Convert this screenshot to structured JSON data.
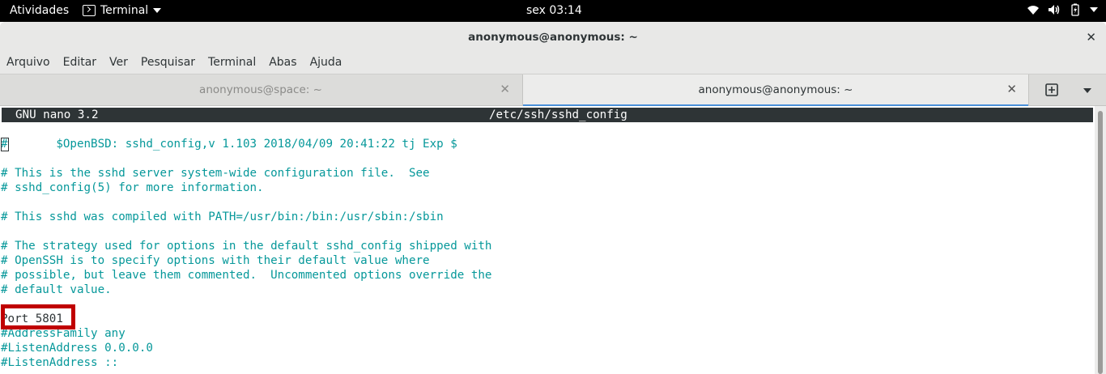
{
  "topbar": {
    "activities": "Atividades",
    "app_name": "Terminal",
    "clock": "sex 03:14",
    "tray_icons": [
      "wifi-icon",
      "volume-icon",
      "battery-icon",
      "system-menu-caret"
    ]
  },
  "window": {
    "title": "anonymous@anonymous: ~",
    "close_glyph": "✕"
  },
  "menu": [
    "Arquivo",
    "Editar",
    "Ver",
    "Pesquisar",
    "Terminal",
    "Abas",
    "Ajuda"
  ],
  "tabs": [
    {
      "label": "anonymous@space: ~",
      "active": false,
      "close_glyph": "✕"
    },
    {
      "label": "anonymous@anonymous: ~",
      "active": true,
      "close_glyph": "✕"
    }
  ],
  "nano": {
    "version": "GNU nano 3.2",
    "filename": "/etc/ssh/sshd_config"
  },
  "lines": [
    "#       $OpenBSD: sshd_config,v 1.103 2018/04/09 20:41:22 tj Exp $",
    "",
    "# This is the sshd server system-wide configuration file.  See",
    "# sshd_config(5) for more information.",
    "",
    "# This sshd was compiled with PATH=/usr/bin:/bin:/usr/sbin:/sbin",
    "",
    "# The strategy used for options in the default sshd_config shipped with",
    "# OpenSSH is to specify options with their default value where",
    "# possible, but leave them commented.  Uncommented options override the",
    "# default value.",
    "",
    "Port 5801",
    "#AddressFamily any",
    "#ListenAddress 0.0.0.0",
    "#ListenAddress ::"
  ],
  "colors": {
    "comment": "#06989a",
    "text": "#2e3436",
    "highlight_box": "#c00000",
    "active_tab_accent": "#4a90d9"
  }
}
